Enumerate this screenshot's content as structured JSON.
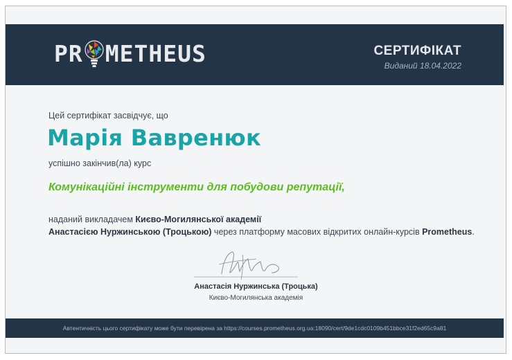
{
  "header": {
    "logo_left": "PR",
    "logo_right": "METHEUS",
    "certificate_title": "СЕРТИФІКАТ",
    "issued_date": "Виданий 18.04.2022"
  },
  "body": {
    "intro": "Цей сертифікат засвідчує, що",
    "recipient_name": "Марія Вавренюк",
    "completed": "успішно закінчив(ла) курс",
    "course_title": "Комунікаційні інструменти для побудови репутації,",
    "given_by_prefix": "наданий викладачем ",
    "institution": "Києво-Могилянської академії",
    "instructor": "Анастасією Нуржинською (Троцькою)",
    "platform_text": " через платформу масових відкритих онлайн-курсів ",
    "platform_name": "Prometheus",
    "period": "."
  },
  "signature": {
    "name": "Анастасія Нуржинська (Троцька)",
    "organization": "Києво-Могилянська академія"
  },
  "footer": {
    "verification": "Автентичність цього сертифікату може бути перевірена за https://courses.prometheus.org.ua:18090/cert/9de1cdc0109b451bbce31f2ed65c9a81"
  },
  "colors": {
    "header_bg": "#243447",
    "name_accent": "#19a5a8",
    "course_accent": "#5dbb22"
  }
}
